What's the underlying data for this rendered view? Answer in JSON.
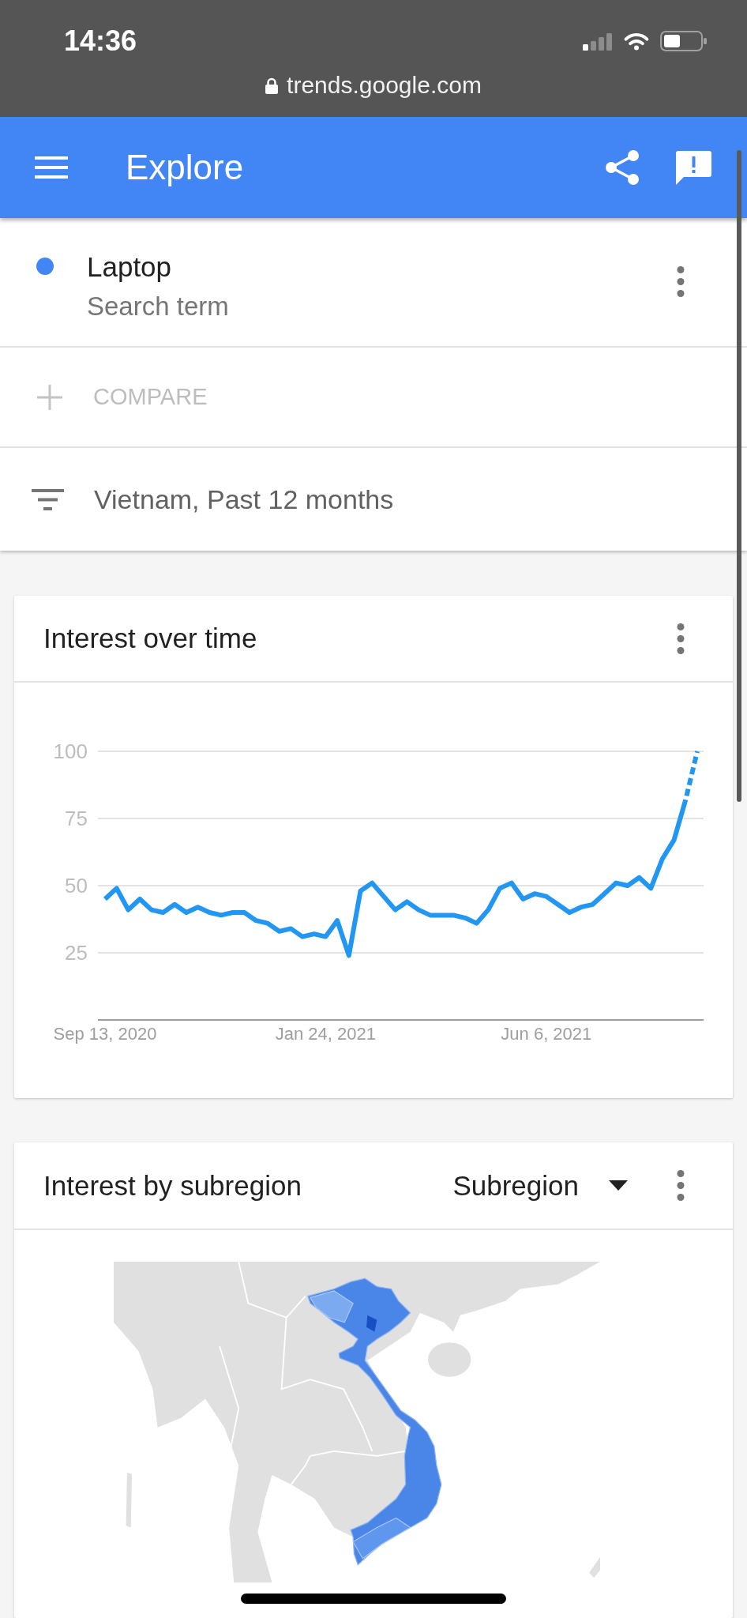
{
  "status_bar": {
    "time": "14:36"
  },
  "browser": {
    "url": "trends.google.com"
  },
  "app_bar": {
    "title": "Explore"
  },
  "terms": [
    {
      "name": "Laptop",
      "type_label": "Search term",
      "color": "#4285f4"
    }
  ],
  "compare": {
    "label": "COMPARE"
  },
  "filter": {
    "label": "Vietnam, Past 12 months"
  },
  "interest_over_time": {
    "title": "Interest over time",
    "chart_data": {
      "type": "line",
      "grid": true,
      "categories": [
        "Sep 13, 2020",
        null,
        null,
        null,
        null,
        null,
        null,
        null,
        null,
        null,
        null,
        null,
        null,
        null,
        null,
        null,
        null,
        null,
        null,
        "Jan 24, 2021",
        null,
        null,
        null,
        null,
        null,
        null,
        null,
        null,
        null,
        null,
        null,
        null,
        null,
        null,
        null,
        null,
        null,
        null,
        "Jun 6, 2021",
        null,
        null,
        null,
        null,
        null,
        null,
        null,
        null,
        null,
        null,
        null,
        null,
        null
      ],
      "series": [
        {
          "color": "#2196f3",
          "line_style": "dashed_end",
          "values": [
            45,
            49,
            41,
            45,
            41,
            40,
            43,
            40,
            42,
            40,
            39,
            40,
            40,
            37,
            36,
            33,
            34,
            31,
            32,
            31,
            37,
            24,
            48,
            51,
            46,
            41,
            44,
            41,
            39,
            39,
            39,
            38,
            36,
            41,
            49,
            51,
            45,
            47,
            46,
            43,
            40,
            42,
            43,
            47,
            51,
            50,
            53,
            49,
            60,
            67,
            82,
            100
          ]
        }
      ],
      "ylim": [
        0,
        100
      ],
      "yticks": [
        25,
        50,
        75,
        100
      ]
    }
  },
  "interest_by_subregion": {
    "title": "Interest by subregion",
    "dropdown": {
      "value": "Subregion"
    }
  }
}
